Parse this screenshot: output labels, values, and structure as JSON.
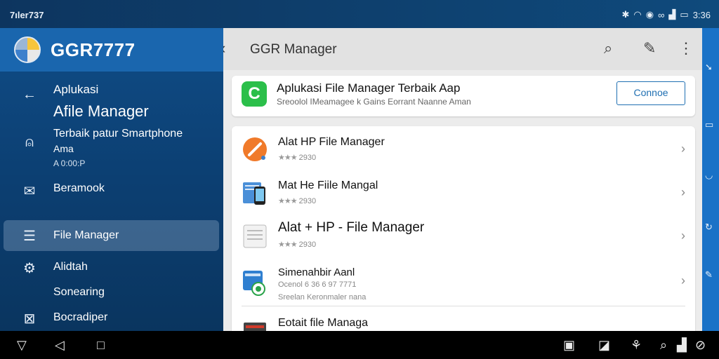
{
  "status": {
    "time": "7ıler737",
    "icons": [
      "bluetooth-icon",
      "wifi-icon",
      "alarm-icon",
      "link-icon",
      "signal-icon",
      "battery-icon"
    ],
    "clock": "3:36"
  },
  "drawer": {
    "title": "GGR7777",
    "items": [
      {
        "icon": "back-arrow-icon",
        "label1": "Aplukasi",
        "label2": "Afile Manager"
      },
      {
        "icon": "bell-icon",
        "label1": "Terbaik patur Smartphone",
        "label2": "Ama",
        "label3": "A 0:00:P"
      },
      {
        "icon": "mail-icon",
        "label1": "Beramook"
      },
      {
        "icon": "list-icon",
        "label1": "File Manager",
        "selected": true
      },
      {
        "icon": "settings-icon",
        "label1": "Alidtah"
      },
      {
        "icon": "",
        "label1": "Sonearing"
      },
      {
        "icon": "close-box-icon",
        "label1": "Bocradiper"
      }
    ]
  },
  "appbar": {
    "title": "GGR Manager",
    "icons": [
      "search-icon",
      "edit-icon",
      "more-icon"
    ]
  },
  "promo": {
    "title": "Aplukasi File Manager Terbaik Aap",
    "subtitle": "Sreoolol IMeamagee k Gains Eorrant Naanne Aman",
    "button": "Connoe"
  },
  "apps": [
    {
      "title": "Alat HP File Manager",
      "rating": "2930",
      "icon": "orange-circle-icon"
    },
    {
      "title": "Mat He Fiile Mangal",
      "rating": "2930",
      "icon": "phone-file-icon"
    },
    {
      "title": "Alat + HP - File Manager",
      "rating": "2930",
      "icon": "document-icon"
    },
    {
      "title": "Simenahbir Aanl",
      "sub1": "Ocenol 6 36 6 97 7771",
      "sub2": "Sreelan Keronmaler nana",
      "icon": "media-icon"
    },
    {
      "title": "Eotait file Managa",
      "icon": "folder-icon"
    }
  ],
  "colors": {
    "drawer": "#0f4c86",
    "drawer_header": "#1a66ae",
    "accent": "#1f6fb2",
    "rail": "#1a72c7",
    "green": "#2bbf4a"
  }
}
